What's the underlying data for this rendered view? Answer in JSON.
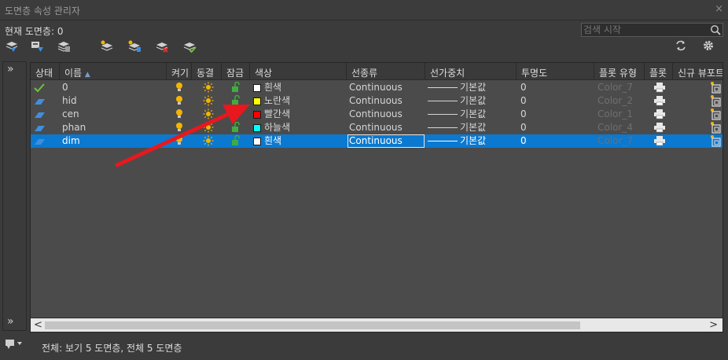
{
  "window": {
    "title": "도면층 속성 관리자",
    "close_glyph": "×"
  },
  "current_layer": {
    "label": "현재 도면층:",
    "value": "0"
  },
  "search": {
    "placeholder": "검색 시작"
  },
  "toolbar": {
    "left_icons": [
      "new-property-filter-icon",
      "new-group-filter-icon",
      "layer-states-manager-icon",
      "new-layer-icon",
      "new-layer-vp-frozen-icon",
      "delete-layer-icon",
      "set-current-icon"
    ],
    "right_icons": [
      "refresh-icon",
      "settings-icon"
    ]
  },
  "left_strip": {
    "top_glyph": "»",
    "bottom_glyph": "»"
  },
  "columns": [
    "상태",
    "이름",
    "켜기",
    "동결",
    "잠금",
    "색상",
    "선종류",
    "선가중치",
    "투명도",
    "플롯 유형",
    "플롯",
    "신규 뷰포트"
  ],
  "sort_glyph": "▲",
  "rows": [
    {
      "status": "current",
      "name": "0",
      "color_hex": "#ffffff",
      "color_name": "흰색",
      "linetype": "Continuous",
      "lineweight": "기본값",
      "transparency": "0",
      "plot_style": "Color_7",
      "selected": false
    },
    {
      "status": "layer",
      "name": "hid",
      "color_hex": "#ffff00",
      "color_name": "노란색",
      "linetype": "Continuous",
      "lineweight": "기본값",
      "transparency": "0",
      "plot_style": "Color_2",
      "selected": false
    },
    {
      "status": "layer",
      "name": "cen",
      "color_hex": "#ff0000",
      "color_name": "빨간색",
      "linetype": "Continuous",
      "lineweight": "기본값",
      "transparency": "0",
      "plot_style": "Color_1",
      "selected": false
    },
    {
      "status": "layer",
      "name": "phan",
      "color_hex": "#00ffff",
      "color_name": "하늘색",
      "linetype": "Continuous",
      "lineweight": "기본값",
      "transparency": "0",
      "plot_style": "Color_4",
      "selected": false
    },
    {
      "status": "layer",
      "name": "dim",
      "color_hex": "#ffffff",
      "color_name": "흰색",
      "linetype": "Continuous",
      "lineweight": "기본값",
      "transparency": "0",
      "plot_style": "Color_7",
      "selected": true
    }
  ],
  "scrollbar": {
    "left_glyph": "<",
    "right_glyph": ">"
  },
  "status_text": "전체: 보기 5 도면층, 전체 5 도면층",
  "colors": {
    "selection": "#0b79d0",
    "annotation_arrow": "#e8181e",
    "current_check": "#6fc23a"
  }
}
